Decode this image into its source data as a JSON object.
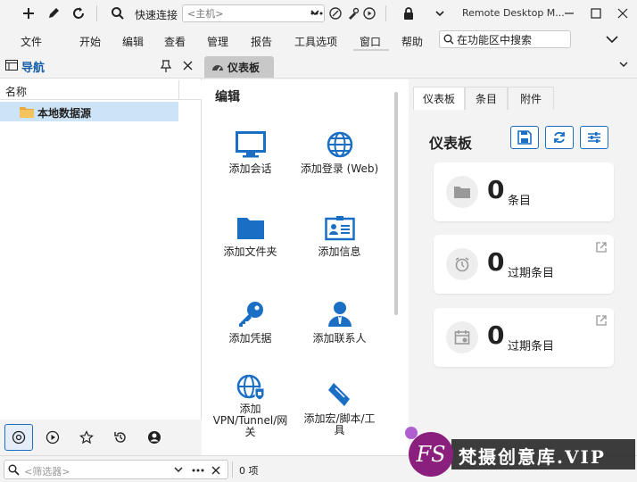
{
  "titlebar": {
    "quick_connect_label": "快速连接",
    "host_placeholder": "<主机>",
    "app_title": "Remote Desktop M..."
  },
  "menu": {
    "items": [
      "文件",
      "开始",
      "编辑",
      "查看",
      "管理",
      "报告",
      "工具选项",
      "窗口",
      "帮助"
    ],
    "search_label": "在功能区中搜索"
  },
  "navigation": {
    "title": "导航",
    "column_name": "名称",
    "tree_item": "本地数据源"
  },
  "filter": {
    "placeholder": "<筛选器>",
    "count_label": "0 项"
  },
  "document_tab": {
    "label": "仪表板"
  },
  "edit": {
    "title": "编辑",
    "actions": [
      {
        "label": "添加会话",
        "icon": "monitor-icon"
      },
      {
        "label": "添加登录 (Web)",
        "icon": "globe-icon"
      },
      {
        "label": "添加文件夹",
        "icon": "folder-icon"
      },
      {
        "label": "添加信息",
        "icon": "id-card-icon"
      },
      {
        "label": "添加凭据",
        "icon": "key-icon"
      },
      {
        "label": "添加联系人",
        "icon": "contact-icon"
      },
      {
        "label": "添加\nVPN/Tunnel/网\n关",
        "icon": "vpn-globe-icon"
      },
      {
        "label": "添加宏/脚本/工\n具",
        "icon": "script-icon"
      }
    ]
  },
  "dashboard": {
    "tabs": [
      "仪表板",
      "条目",
      "附件"
    ],
    "title": "仪表板",
    "cards": [
      {
        "value": "0",
        "label": "条目",
        "icon": "folder-icon"
      },
      {
        "value": "0",
        "label": "过期条目",
        "icon": "alarm-clock-icon"
      },
      {
        "value": "0",
        "label": "过期条目",
        "icon": "calendar-icon"
      }
    ]
  },
  "watermark": {
    "logo": "FS",
    "text": "梵摄创意库.VIP"
  },
  "colors": {
    "accent": "#1a6fc4",
    "selected_row": "#cde4f7"
  }
}
